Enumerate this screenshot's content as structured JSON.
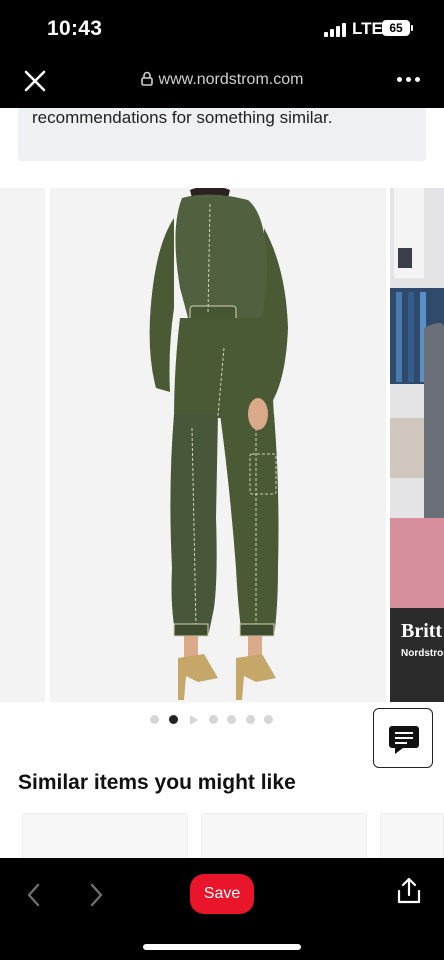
{
  "status_bar": {
    "time": "10:43",
    "network": "LTE",
    "battery": "65"
  },
  "browser": {
    "url": "www.nordstrom.com"
  },
  "notice": {
    "text": "recommendations for something similar."
  },
  "carousel": {
    "dot_count": 7,
    "active_index": 1,
    "right_card_brand": "Britt",
    "right_card_sub": "Nordstrom"
  },
  "similar": {
    "title": "Similar items you might like"
  },
  "toolbar": {
    "save_label": "Save"
  },
  "colors": {
    "accent": "#e8152b",
    "jumpsuit": "#4a5a35"
  }
}
